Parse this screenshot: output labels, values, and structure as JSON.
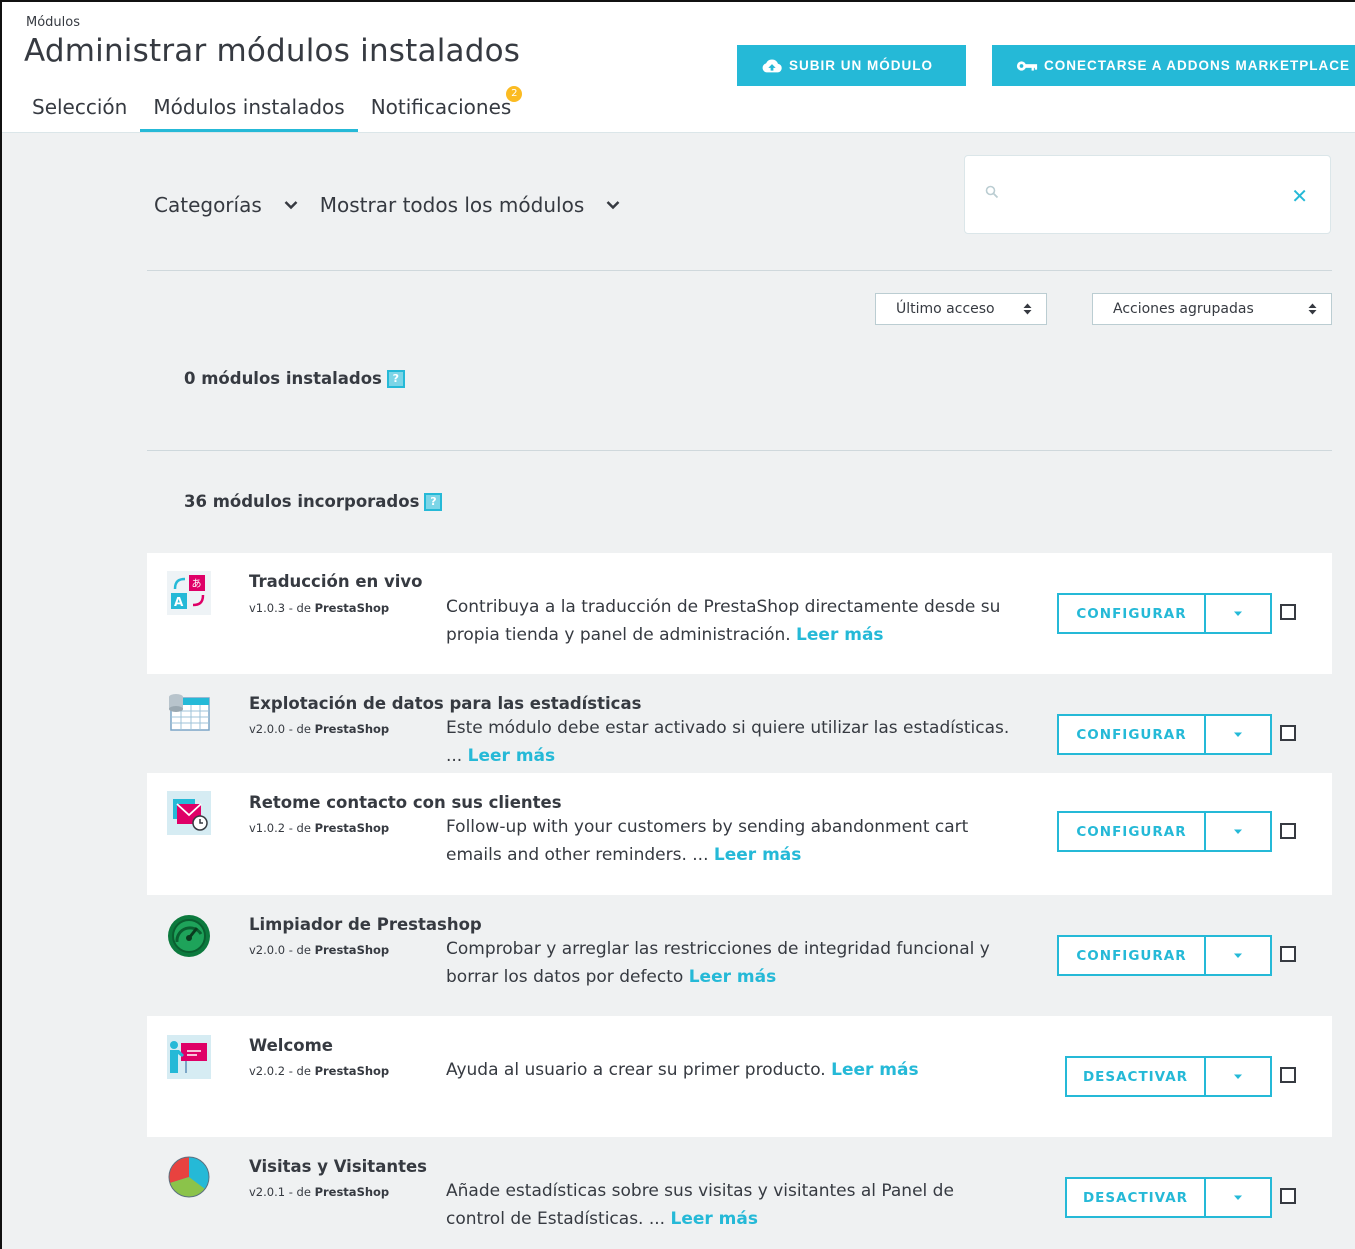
{
  "header": {
    "breadcrumb": "Módulos",
    "title": "Administrar módulos instalados",
    "upload_button": "SUBIR UN MÓDULO",
    "connect_button": "CONECTARSE A ADDONS MARKETPLACE",
    "tabs": [
      {
        "label": "Selección"
      },
      {
        "label": "Módulos instalados"
      },
      {
        "label": "Notificaciones",
        "badge": "2"
      }
    ]
  },
  "filters": {
    "categories": "Categorías",
    "show": "Mostrar todos los módulos",
    "search_value": ""
  },
  "sort": {
    "last_access": "Último acceso",
    "bulk_actions": "Acciones agrupadas"
  },
  "sections": {
    "installed": "0 módulos instalados",
    "builtin": "36 módulos incorporados",
    "help": "?"
  },
  "colors": {
    "accent": "#25b9d7",
    "badge": "#fbbb22",
    "background": "#eff1f2"
  },
  "modules": [
    {
      "icon": "translation-icon",
      "name": "Traducción en vivo",
      "version": "v1.0.3 - de ",
      "author": "PrestaShop",
      "desc": "Contribuya a la traducción de PrestaShop directamente desde su propia tienda y panel de administración.",
      "more": "Leer más",
      "action": "CONFIGURAR"
    },
    {
      "icon": "database-icon",
      "name": "Explotación de datos para las estadísticas",
      "version": "v2.0.0 - de ",
      "author": "PrestaShop",
      "desc": "Este módulo debe estar activado si quiere utilizar las estadísticas. ...",
      "more": "Leer más",
      "action": "CONFIGURAR"
    },
    {
      "icon": "email-clock-icon",
      "name": "Retome contacto con sus clientes",
      "version": "v1.0.2 - de ",
      "author": "PrestaShop",
      "desc": "Follow-up with your customers by sending abandonment cart emails and other reminders. ...",
      "more": "Leer más",
      "action": "CONFIGURAR"
    },
    {
      "icon": "gauge-icon",
      "name": "Limpiador de Prestashop",
      "version": "v2.0.0 - de ",
      "author": "PrestaShop",
      "desc": "Comprobar y arreglar las restricciones de integridad funcional y borrar los datos por defecto",
      "more": "Leer más",
      "action": "CONFIGURAR"
    },
    {
      "icon": "presentation-icon",
      "name": "Welcome",
      "version": "v2.0.2 - de ",
      "author": "PrestaShop",
      "desc": "Ayuda al usuario a crear su primer producto.",
      "more": "Leer más",
      "action": "DESACTIVAR"
    },
    {
      "icon": "pie-chart-icon",
      "name": "Visitas y Visitantes",
      "version": "v2.0.1 - de ",
      "author": "PrestaShop",
      "desc": "Añade estadísticas sobre sus visitas y visitantes al Panel de control de Estadísticas. ...",
      "more": "Leer más",
      "action": "DESACTIVAR"
    }
  ]
}
